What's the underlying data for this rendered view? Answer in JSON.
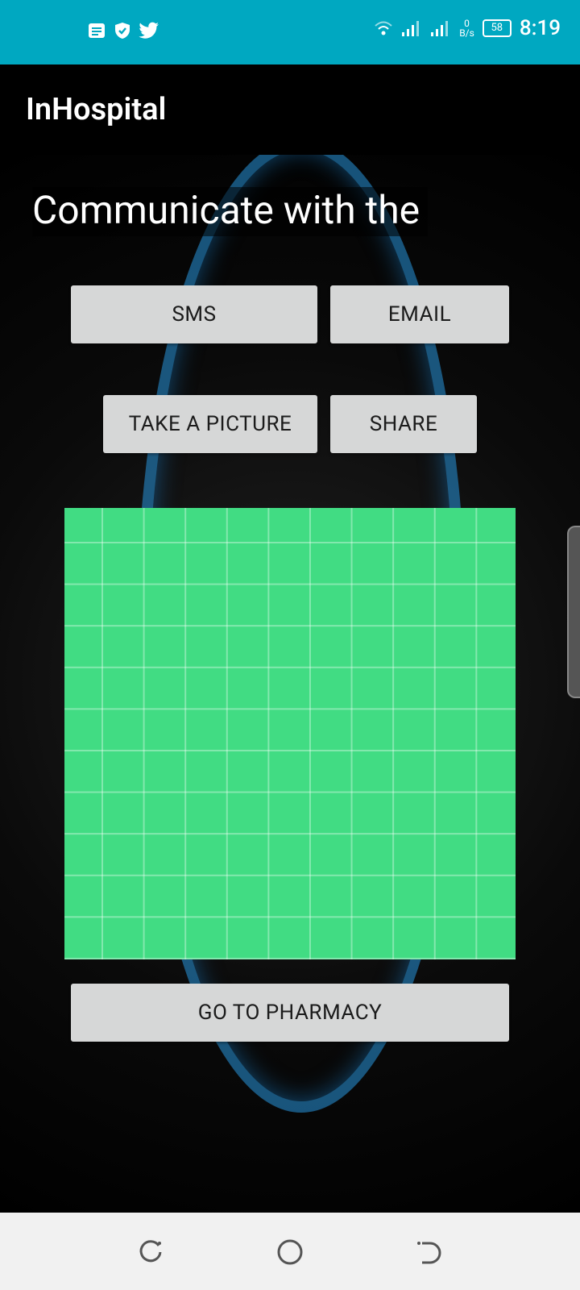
{
  "status_bar": {
    "time": "8:19",
    "data_rate_value": "0",
    "data_rate_unit": "B/s",
    "battery": "58",
    "left_icons": [
      "notes-icon",
      "shield-check-icon",
      "twitter-icon"
    ],
    "right_icons": [
      "wifi-icon",
      "signal-icon",
      "signal-icon"
    ],
    "color": "#00A8C1"
  },
  "app_bar": {
    "title": "InHospital"
  },
  "main": {
    "headline": "Communicate with the",
    "buttons": {
      "sms": "SMS",
      "email": "EMAIL",
      "take_picture": "TAKE A PICTURE",
      "share": "SHARE",
      "pharmacy": "GO TO PHARMACY"
    },
    "grid_color": "#41DC83",
    "button_color": "#D6D7D7"
  },
  "nav_bar": {
    "icons": [
      "recent-apps-icon",
      "home-icon",
      "back-icon"
    ]
  }
}
